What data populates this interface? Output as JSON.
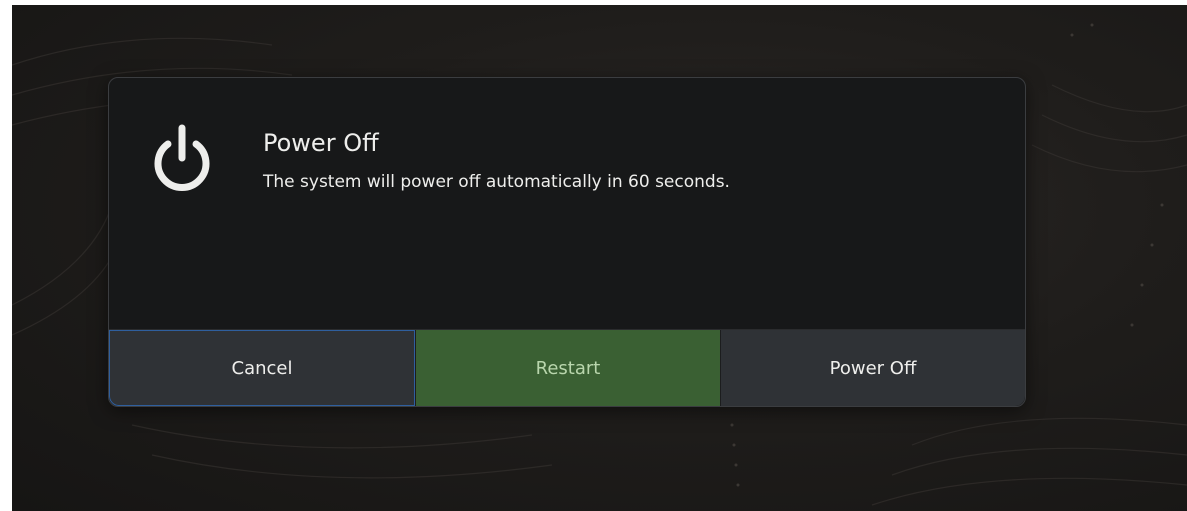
{
  "dialog": {
    "icon": "power-icon",
    "title": "Power Off",
    "message": "The system will power off automatically in 60 seconds.",
    "buttons": {
      "cancel": "Cancel",
      "restart": "Restart",
      "power_off": "Power Off"
    }
  },
  "colors": {
    "dialog_background": "#171819",
    "button_background": "#2f3236",
    "restart_background": "#3a6033",
    "focus_border": "#2f5f9e",
    "text": "#eeeeec"
  }
}
